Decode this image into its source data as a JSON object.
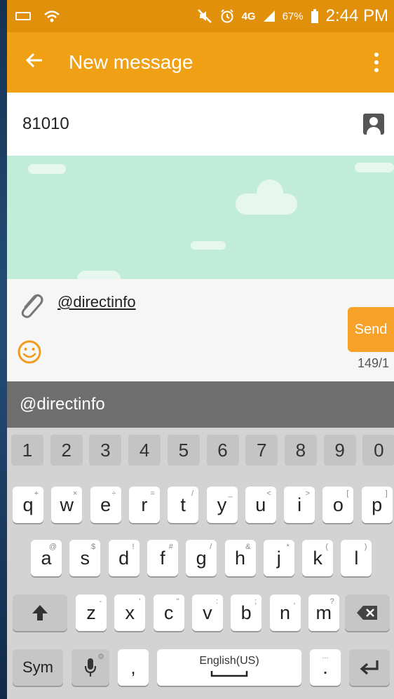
{
  "status_bar": {
    "battery_percent": "67%",
    "time": "2:44 PM",
    "network_label": "4G",
    "icons": [
      "keyboard-icon",
      "wifi-icon",
      "mute-icon",
      "alarm-icon",
      "lte-icon",
      "signal-icon",
      "battery-icon"
    ]
  },
  "app_bar": {
    "title": "New message",
    "back_icon": "back-arrow-icon",
    "menu_icon": "overflow-menu-icon"
  },
  "recipient": {
    "value": "81010",
    "icon": "contact-icon"
  },
  "composer": {
    "message_text": "@directinfo",
    "send_label": "Send",
    "char_counter": "149/1",
    "attach_icon": "paperclip-icon",
    "emoji_icon": "emoji-icon"
  },
  "suggestion": {
    "text": "@directinfo"
  },
  "keyboard": {
    "number_row": [
      "1",
      "2",
      "3",
      "4",
      "5",
      "6",
      "7",
      "8",
      "9",
      "0"
    ],
    "row1": [
      {
        "key": "q",
        "hint": "+"
      },
      {
        "key": "w",
        "hint": "×"
      },
      {
        "key": "e",
        "hint": "÷"
      },
      {
        "key": "r",
        "hint": "="
      },
      {
        "key": "t",
        "hint": "/"
      },
      {
        "key": "y",
        "hint": "_"
      },
      {
        "key": "u",
        "hint": "<"
      },
      {
        "key": "i",
        "hint": ">"
      },
      {
        "key": "o",
        "hint": "["
      },
      {
        "key": "p",
        "hint": "]"
      }
    ],
    "row2": [
      {
        "key": "a",
        "hint": "@"
      },
      {
        "key": "s",
        "hint": "$"
      },
      {
        "key": "d",
        "hint": "!"
      },
      {
        "key": "f",
        "hint": "#"
      },
      {
        "key": "g",
        "hint": "/"
      },
      {
        "key": "h",
        "hint": "&"
      },
      {
        "key": "j",
        "hint": "*"
      },
      {
        "key": "k",
        "hint": "("
      },
      {
        "key": "l",
        "hint": ")"
      }
    ],
    "row3": [
      {
        "key": "z",
        "hint": "-"
      },
      {
        "key": "x",
        "hint": "'"
      },
      {
        "key": "c",
        "hint": "\""
      },
      {
        "key": "v",
        "hint": ":"
      },
      {
        "key": "b",
        "hint": ";"
      },
      {
        "key": "n",
        "hint": ","
      },
      {
        "key": "m",
        "hint": "?"
      }
    ],
    "sym_label": "Sym",
    "comma_label": ",",
    "space_label": "English(US)",
    "period_label": ".",
    "period_hint": "...",
    "shift_icon": "shift-icon",
    "backspace_icon": "backspace-icon",
    "mic_icon": "microphone-icon",
    "enter_icon": "enter-icon"
  },
  "colors": {
    "status_bar": "#e0900a",
    "app_bar": "#f0a015",
    "send_button": "#f6a127",
    "conversation_bg": "#c2ecda",
    "suggestion_bar": "#6e6e6e",
    "keyboard_bg": "#d3d3d3"
  }
}
